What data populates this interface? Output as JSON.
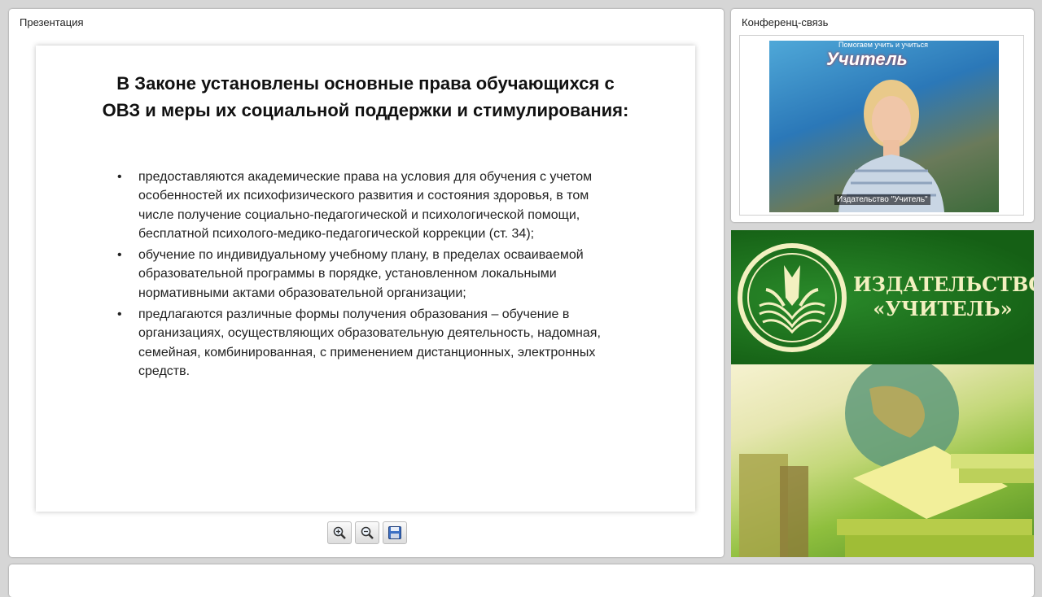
{
  "presentation": {
    "panel_title": "Презентация",
    "slide": {
      "title": "В Законе установлены основные права обучающихся с ОВЗ и меры их социальной поддержки и стимулирования:",
      "bullets": [
        "предоставляются академические права на условия для обучения с учетом особенностей их психофизического развития и состояния здоровья, в том числе получение социально-педагогической и психологической помощи, бесплатной психолого-медико-педагогической коррекции (ст. 34);",
        "обучение по индивидуальному учебному плану, в пределах осваиваемой образовательной программы в порядке, установленном локальными нормативными актами образовательной организации;",
        "предлагаются различные формы получения образования – обучение в организациях, осуществляющих образовательную деятельность, надомная, семейная, комбинированная, с применением дистанционных, электронных средств."
      ],
      "bullet_char": "•"
    },
    "toolbar": {
      "zoom_in_icon": "zoom-in-icon",
      "zoom_out_icon": "zoom-out-icon",
      "save_icon": "floppy-disk-icon"
    }
  },
  "conference": {
    "panel_title": "Конференц-связь",
    "video_caption": "Издательство \"Учитель\"",
    "backdrop_text": "Помогаем учить и учиться",
    "backdrop_brand": "Учитель"
  },
  "publisher": {
    "name_line1": "ИЗДАТЕЛЬСТВО",
    "name_line2": "«УЧИТЕЛЬ»",
    "logo_icon": "open-book-logo-icon",
    "brand_color": "#1d6b1d"
  }
}
